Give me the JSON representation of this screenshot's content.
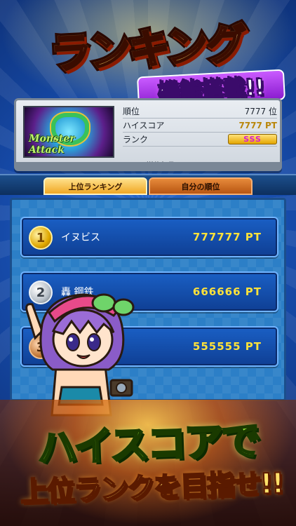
{
  "banner": {
    "title": "ランキング",
    "subtitle": "機能搭載!!"
  },
  "profile": {
    "thumbnail_logo": "Monster Attack",
    "rows": [
      {
        "label": "順位",
        "value": "7777 位"
      },
      {
        "label": "ハイスコア",
        "value": "7777 PT"
      },
      {
        "label": "ランク",
        "value": "SSS"
      }
    ],
    "send_date": "送信年月日：2018/01/01"
  },
  "tabs": [
    {
      "label": "上位ランキング",
      "active": true
    },
    {
      "label": "自分の順位",
      "active": false
    }
  ],
  "ranking": [
    {
      "rank": "1",
      "name": "イヌビス",
      "score": "777777 PT",
      "medal": "gold"
    },
    {
      "rank": "2",
      "name": "轟 鋼鉄",
      "score": "666666 PT",
      "medal": "silver"
    },
    {
      "rank": "3",
      "name": "",
      "score": "555555 PT",
      "medal": "bronze"
    }
  ],
  "slogan": {
    "line1": "ハイスコアで",
    "line2": "上位ランクを目指せ!!"
  },
  "colors": {
    "score_yellow": "#ffe23a",
    "tab_active": "#f0a724",
    "tab_inactive": "#b85512",
    "rank_badge_text": "#d81fd0"
  },
  "icons": [
    "gold-medal-icon",
    "silver-medal-icon",
    "bronze-medal-icon"
  ]
}
